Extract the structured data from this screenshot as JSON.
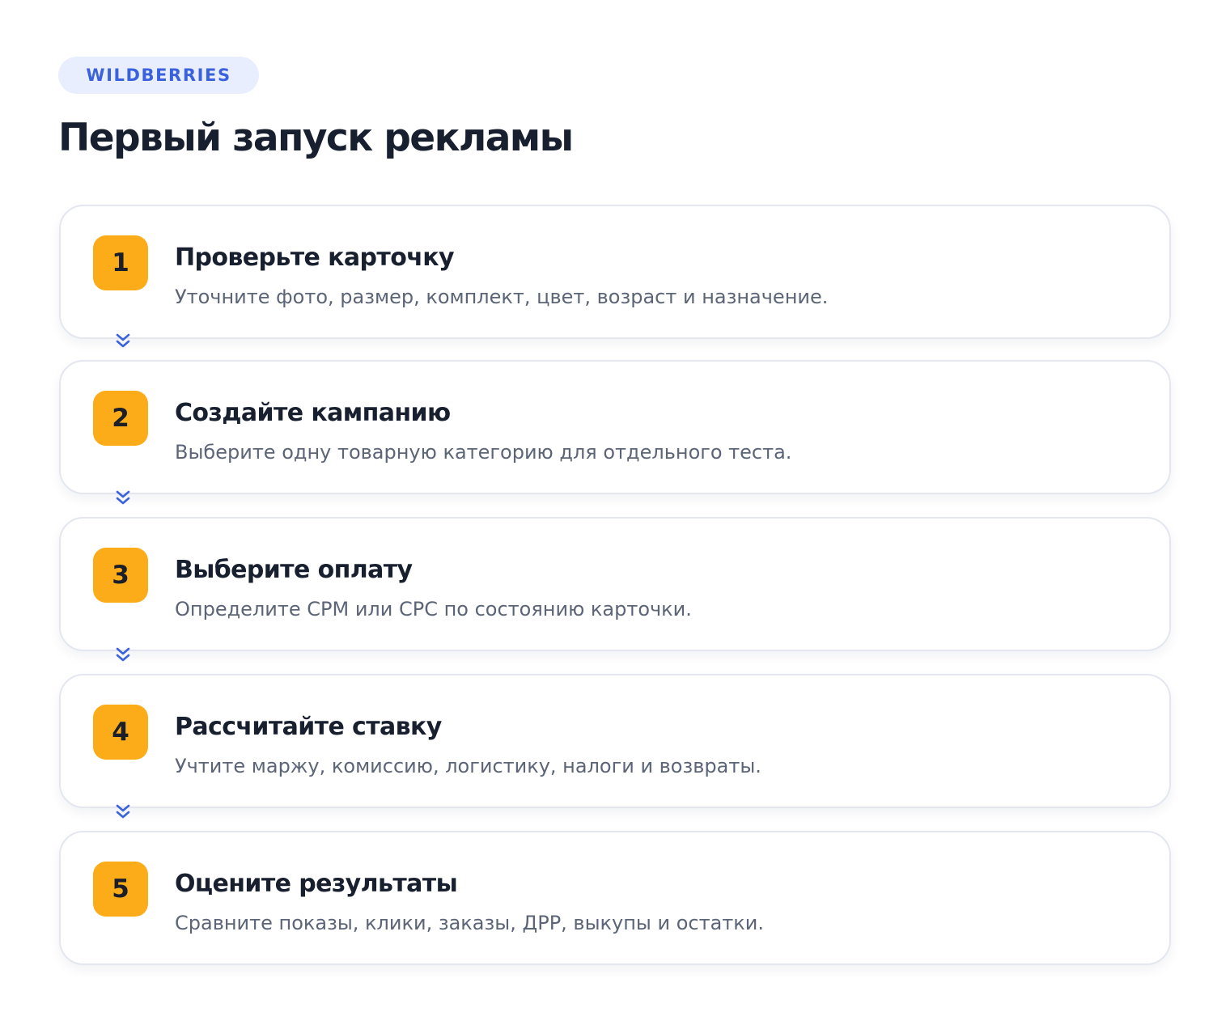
{
  "badge": {
    "label": "WILDBERRIES"
  },
  "title": "Первый запуск рекламы",
  "colors": {
    "accent": "#fbac18",
    "badge_bg": "#e8eefd",
    "badge_text": "#3a62dc",
    "connector": "#3a62dc",
    "title": "#18202f",
    "description": "#5c6577",
    "card_border": "#e4e7ef"
  },
  "steps": [
    {
      "number": "1",
      "title": "Проверьте карточку",
      "description": "Уточните фото, размер, комплект, цвет, возраст и назначение."
    },
    {
      "number": "2",
      "title": "Создайте кампанию",
      "description": "Выберите одну товарную категорию для отдельного теста."
    },
    {
      "number": "3",
      "title": "Выберите оплату",
      "description": "Определите CPM или CPC по состоянию карточки."
    },
    {
      "number": "4",
      "title": "Рассчитайте ставку",
      "description": "Учтите маржу, комиссию, логистику, налоги и возвраты."
    },
    {
      "number": "5",
      "title": "Оцените результаты",
      "description": "Сравните показы, клики, заказы, ДРР, выкупы и остатки."
    }
  ],
  "connector_icon": "double-chevron-down-icon"
}
